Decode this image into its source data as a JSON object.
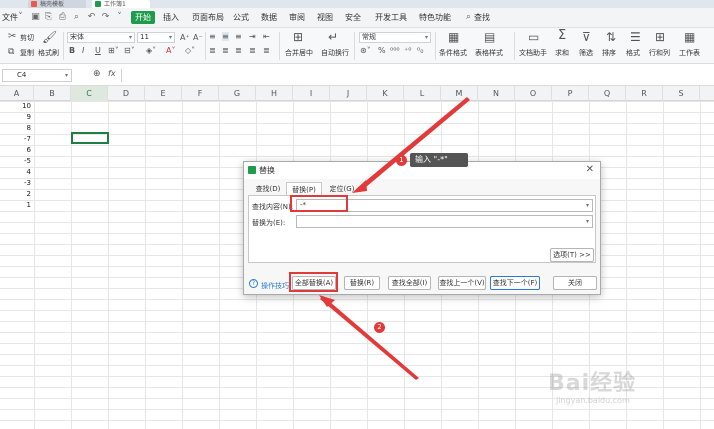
{
  "tabs": [
    "稿壳模板",
    "工作簿1"
  ],
  "menu": {
    "file": "文件",
    "start": "开始",
    "items": [
      "插入",
      "页面布局",
      "公式",
      "数据",
      "审阅",
      "视图",
      "安全",
      "开发工具",
      "特色功能"
    ],
    "search": "查找"
  },
  "ribbon": {
    "cut": "剪切",
    "copy": "复制",
    "format_painter": "格式刷",
    "font_name": "宋体",
    "font_size": "11",
    "merge_center": "合并居中",
    "wrap": "自动换行",
    "number_format": "常规",
    "cond_format": "条件格式",
    "table_style": "表格样式",
    "doc_helper": "文档助手",
    "sum": "求和",
    "filter": "筛选",
    "sort": "排序",
    "format": "格式",
    "rowcol": "行和列",
    "worksheet": "工作表"
  },
  "formula_bar": {
    "cell_ref": "C4",
    "fx": "fx"
  },
  "columns": [
    "A",
    "B",
    "C",
    "D",
    "E",
    "F",
    "G",
    "H",
    "I",
    "J",
    "K",
    "L",
    "M",
    "N",
    "O",
    "P",
    "Q",
    "R",
    "S"
  ],
  "cell_values": [
    "10",
    "9",
    "8",
    "-7",
    "6",
    "-5",
    "4",
    "-3",
    "2",
    "1"
  ],
  "dialog": {
    "title": "替换",
    "tabs": [
      "查找(D)",
      "替换(P)",
      "定位(G)"
    ],
    "find_label": "查找内容(N):",
    "find_value": "-*",
    "replace_label": "替换为(E):",
    "replace_value": "",
    "options_btn": "选项(T) >>",
    "tips": "操作技巧",
    "buttons": [
      "全部替换(A)",
      "替换(R)",
      "查找全部(I)",
      "查找上一个(V)",
      "查找下一个(F)",
      "关闭"
    ]
  },
  "annotation": {
    "tag": "输入 \"-*\"",
    "badge1": "1",
    "badge2": "2"
  },
  "watermark": {
    "text": "Bai经验",
    "sub": "jingyan.baidu.com"
  },
  "colors": {
    "accent_green": "#1e9c4b",
    "annotation_red": "#e23a3a",
    "link_blue": "#2a7bd3"
  }
}
